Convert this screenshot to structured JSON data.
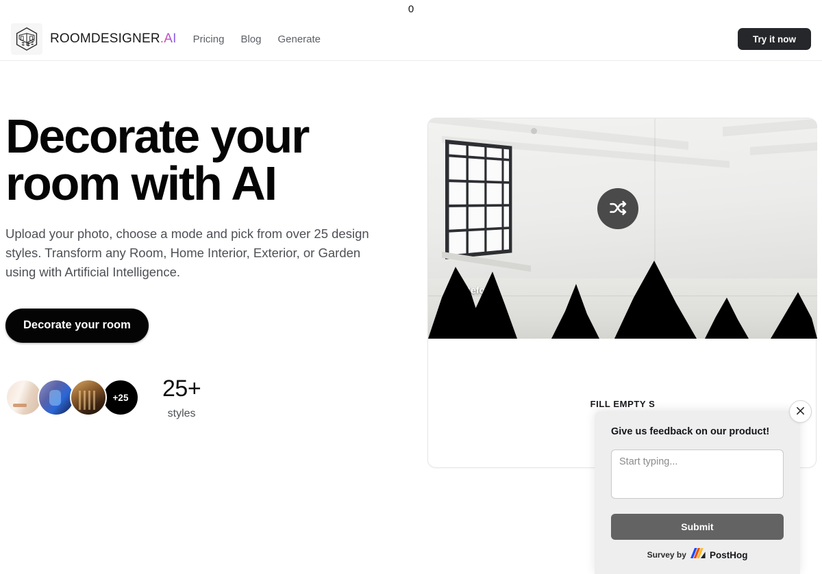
{
  "top_counter": "0",
  "header": {
    "logo_icon": "isometric-room-cube-icon",
    "brand_name": "ROOMDESIGNER",
    "brand_suffix": ".AI",
    "brand_gradient_from": "#f0507e",
    "brand_gradient_to": "#7b68ee",
    "nav": [
      {
        "label": "Pricing"
      },
      {
        "label": "Blog"
      },
      {
        "label": "Generate"
      }
    ],
    "cta_label": "Try it now",
    "cta_bg": "#26272b"
  },
  "hero": {
    "title": "Decorate your room with AI",
    "subtitle": "Upload your photo, choose a mode and pick from over 25 design styles. Transform any Room, Home Interior, Exterior, or Garden using with Artificial Intelligence.",
    "cta_label": "Decorate your room",
    "styles": {
      "count": "25+",
      "label": "styles",
      "more_badge": "+25",
      "avatars": [
        {
          "name": "style-thumb-minimal-bedroom"
        },
        {
          "name": "style-thumb-blue-futuristic"
        },
        {
          "name": "style-thumb-gothic-interior"
        }
      ]
    }
  },
  "preview": {
    "before_label": "Before",
    "shuffle_icon": "shuffle-icon",
    "caption": "FILL EMPTY S"
  },
  "survey": {
    "title": "Give us feedback on our product!",
    "input_value": "",
    "input_placeholder": "Start typing...",
    "submit_label": "Submit",
    "footer_prefix": "Survey by",
    "footer_brand": "PostHog",
    "close_icon": "close-icon",
    "bg": "#eeeeee",
    "submit_bg": "#636363"
  }
}
